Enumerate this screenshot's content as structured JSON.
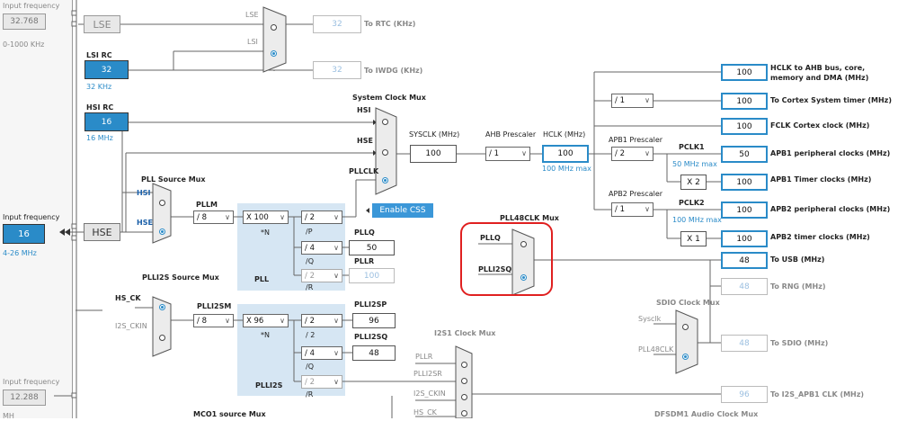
{
  "left_panel": {
    "lse": {
      "label": "Input frequency",
      "value": "32.768",
      "range": "0-1000 KHz"
    },
    "hse": {
      "label": "Input frequency",
      "value": "16",
      "range": "4-26 MHz"
    },
    "i2s": {
      "label": "Input frequency",
      "value": "12.288",
      "unit": "MH"
    }
  },
  "sources": {
    "lse": "LSE",
    "lsi_title": "LSI RC",
    "lsi_value": "32",
    "lsi_freq": "32 KHz",
    "hsi_title": "HSI RC",
    "hsi_value": "16",
    "hsi_freq": "16 MHz",
    "hse": "HSE"
  },
  "rtc": {
    "lse_in": "LSE",
    "lsi_in": "LSI",
    "rtc_value": "32",
    "rtc_label": "To RTC (KHz)",
    "iwdg_value": "32",
    "iwdg_label": "To IWDG (KHz)"
  },
  "pll_source_mux": {
    "title": "PLL Source Mux",
    "hsi": "HSI",
    "hse": "HSE"
  },
  "pll": {
    "pllm_label": "PLLM",
    "pllm": "/ 8",
    "n_value": "X 100",
    "n_label": "*N",
    "p_value": "/ 2",
    "p_label": "/P",
    "q_value": "/ 4",
    "q_label": "/Q",
    "r_value": "/ 2",
    "r_label": "/R",
    "pllq_label": "PLLQ",
    "pllq_value": "50",
    "pllr_label": "PLLR",
    "pllr_value": "100",
    "name": "PLL"
  },
  "sysclk_mux": {
    "title": "System Clock Mux",
    "hsi": "HSI",
    "hse": "HSE",
    "pllclk": "PLLCLK",
    "enable_css": "Enable CSS"
  },
  "core": {
    "sysclk_label": "SYSCLK (MHz)",
    "sysclk_value": "100",
    "ahb_label": "AHB Prescaler",
    "ahb_value": "/ 1",
    "hclk_label": "HCLK (MHz)",
    "hclk_value": "100",
    "hclk_max": "100 MHz max",
    "apb1_label": "APB1 Prescaler",
    "apb1_value": "/ 2",
    "pclk1_label": "PCLK1",
    "pclk1_max": "50 MHz max",
    "apb2_label": "APB2 Prescaler",
    "apb2_value": "/ 1",
    "pclk2_label": "PCLK2",
    "pclk2_max": "100 MHz max",
    "cortex_div": "/ 1",
    "x2": "X 2",
    "x1": "X 1"
  },
  "outputs": [
    {
      "value": "100",
      "label": "HCLK to AHB bus, core, memory and DMA (MHz)"
    },
    {
      "value": "100",
      "label": "To Cortex System timer (MHz)"
    },
    {
      "value": "100",
      "label": "FCLK Cortex clock (MHz)"
    },
    {
      "value": "50",
      "label": "APB1 peripheral clocks (MHz)"
    },
    {
      "value": "100",
      "label": "APB1 Timer clocks (MHz)"
    },
    {
      "value": "100",
      "label": "APB2 peripheral clocks (MHz)"
    },
    {
      "value": "100",
      "label": "APB2 timer clocks (MHz)"
    },
    {
      "value": "48",
      "label": "To USB (MHz)"
    },
    {
      "value": "48",
      "label": "To RNG (MHz)"
    },
    {
      "value": "48",
      "label": "To SDIO (MHz)"
    },
    {
      "value": "96",
      "label": "To I2S_APB1 CLK (MHz)"
    }
  ],
  "pll48": {
    "title": "PLL48CLK Mux",
    "pllq": "PLLQ",
    "plli2sq": "PLLI2SQ"
  },
  "plli2s_source": {
    "title": "PLLI2S Source Mux",
    "hs_ck": "HS_CK",
    "i2s_ckin": "I2S_CKIN"
  },
  "plli2s": {
    "m_label": "PLLI2SM",
    "m_value": "/ 8",
    "n_value": "X 96",
    "n_label": "*N",
    "p_value": "/ 2",
    "p_label": "/P",
    "q_value": "/ 4",
    "q_label": "/Q",
    "r_value": "/ 2",
    "r_label": "/R",
    "sp_label": "PLLI2SP",
    "sp_value": "96",
    "sq_label": "PLLI2SQ",
    "sq_value": "48",
    "name": "PLLI2S"
  },
  "sdio_mux": {
    "title": "SDIO Clock Mux",
    "sysclk": "Sysclk",
    "pll48clk": "PLL48CLK"
  },
  "i2s1_mux": {
    "title": "I2S1 Clock Mux",
    "pllr": "PLLR",
    "plli2sr": "PLLI2SR",
    "i2s_ckin": "I2S_CKIN",
    "hs_ck": "HS_CK"
  },
  "bottom": {
    "mco1": "MCO1 source Mux",
    "dfsdm": "DFSDM1 Audio Clock Mux"
  }
}
